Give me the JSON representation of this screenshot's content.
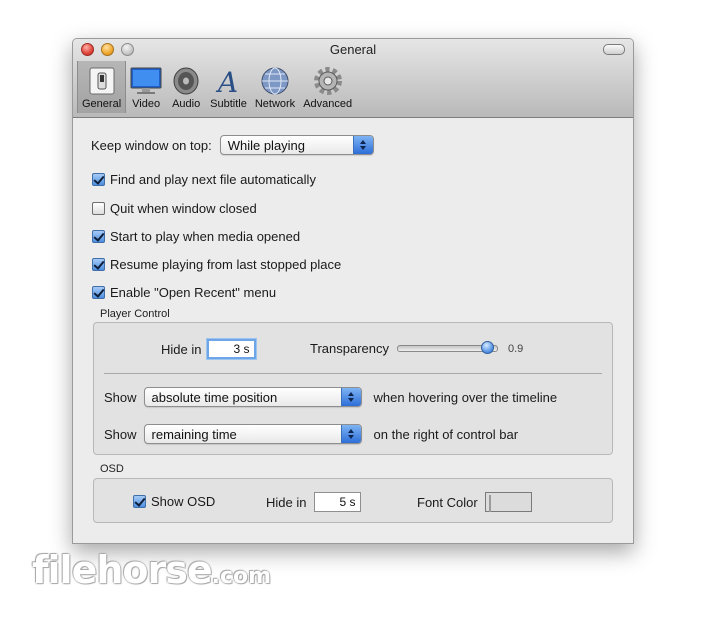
{
  "window": {
    "title": "General"
  },
  "toolbar": {
    "items": [
      {
        "label": "General",
        "icon": "switch-icon",
        "selected": true
      },
      {
        "label": "Video",
        "icon": "monitor-icon"
      },
      {
        "label": "Audio",
        "icon": "speaker-icon"
      },
      {
        "label": "Subtitle",
        "icon": "letter-a-icon"
      },
      {
        "label": "Network",
        "icon": "globe-icon"
      },
      {
        "label": "Advanced",
        "icon": "gear-icon"
      }
    ]
  },
  "general": {
    "keep_on_top_label": "Keep window on top:",
    "keep_on_top_value": "While playing",
    "checkboxes": [
      {
        "label": "Find and play next file automatically",
        "checked": true
      },
      {
        "label": "Quit when window closed",
        "checked": false
      },
      {
        "label": "Start to play when media opened",
        "checked": true
      },
      {
        "label": "Resume playing from last stopped place",
        "checked": true
      },
      {
        "label": "Enable \"Open Recent\" menu",
        "checked": true
      }
    ]
  },
  "player_control": {
    "title": "Player Control",
    "hide_in_label": "Hide in",
    "hide_in_value": "3 s",
    "transparency_label": "Transparency",
    "transparency_value": "0.9",
    "transparency_level": 0.9,
    "show_label_1": "Show",
    "show_value_1": "absolute time position",
    "show_suffix_1": "when hovering over the timeline",
    "show_label_2": "Show",
    "show_value_2": "remaining time",
    "show_suffix_2": "on the right of control bar"
  },
  "osd": {
    "title": "OSD",
    "show_osd_label": "Show OSD",
    "show_osd_checked": true,
    "hide_in_label": "Hide in",
    "hide_in_value": "5 s",
    "font_color_label": "Font Color",
    "font_color": "#ffffff"
  },
  "watermark": {
    "main": "filehorse",
    "tld": ".com"
  }
}
